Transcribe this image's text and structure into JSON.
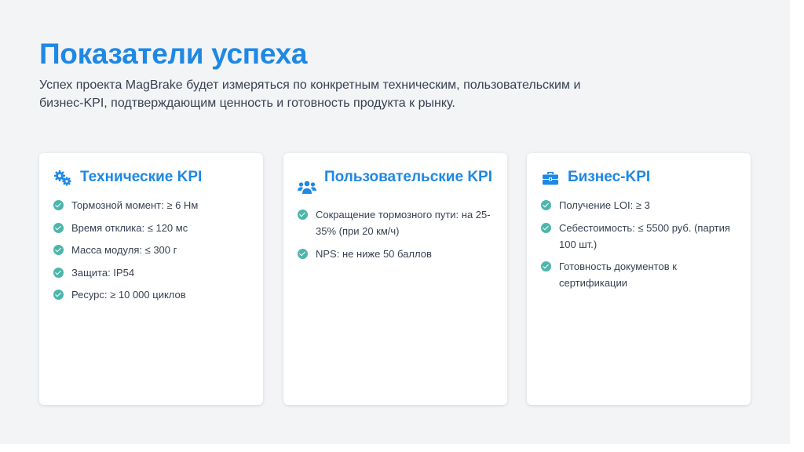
{
  "title": "Показатели успеха",
  "subtitle": "Успех проекта MagBrake будет измеряться по конкретным техническим, пользовательским и бизнес-KPI, подтверждающим ценность и готовность продукта к рынку.",
  "cards": [
    {
      "title": "Технические KPI",
      "icon": "gears-icon",
      "items": [
        "Тормозной момент: ≥ 6 Нм",
        "Время отклика: ≤ 120 мс",
        "Масса модуля: ≤ 300 г",
        "Защита: IP54",
        "Ресурс: ≥ 10 000 циклов"
      ]
    },
    {
      "title": "Пользовательские KPI",
      "icon": "users-icon",
      "items": [
        "Сокращение тормозного пути: на 25-35% (при 20 км/ч)",
        "NPS: не ниже 50 баллов"
      ]
    },
    {
      "title": "Бизнес-KPI",
      "icon": "briefcase-icon",
      "items": [
        "Получение LOI: ≥ 3",
        "Себестоимость: ≤ 5500 руб. (партия 100 шт.)",
        "Готовность документов к сертификации"
      ]
    }
  ],
  "colors": {
    "accent": "#1e88e5",
    "check": "#4db6ac",
    "text": "#374151",
    "background": "#f3f4f6"
  }
}
